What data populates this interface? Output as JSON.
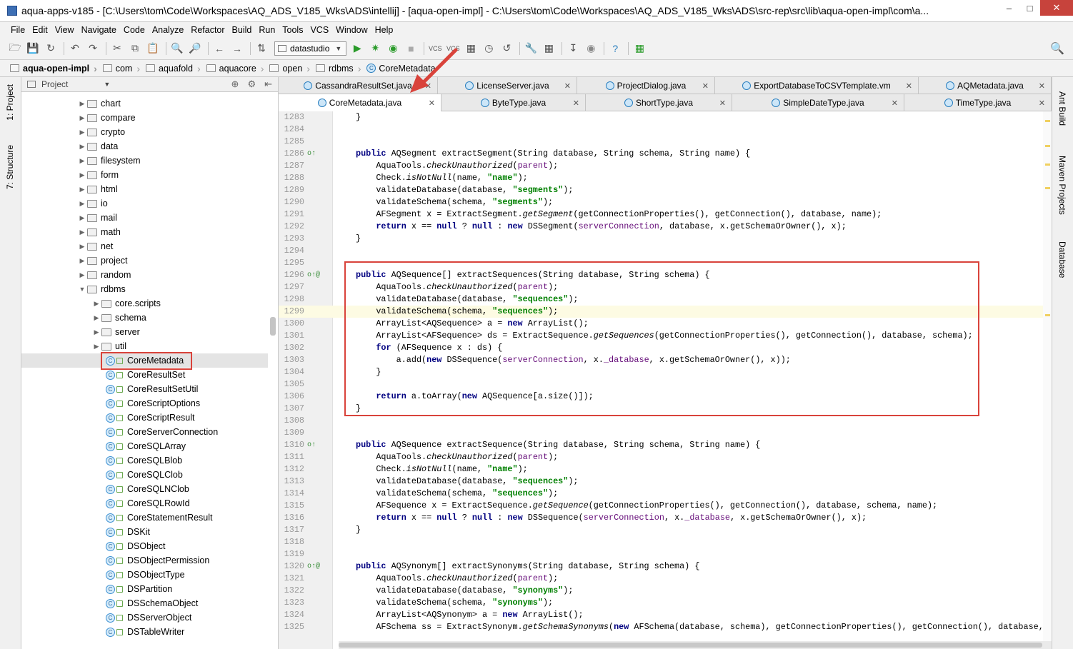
{
  "window": {
    "title": "aqua-apps-v185 - [C:\\Users\\tom\\Code\\Workspaces\\AQ_ADS_V185_Wks\\ADS\\intellij] - [aqua-open-impl] - C:\\Users\\tom\\Code\\Workspaces\\AQ_ADS_V185_Wks\\ADS\\src-rep\\src\\lib\\aqua-open-impl\\com\\a...",
    "buttons": {
      "minimize": "–",
      "maximize": "□",
      "close": "✕"
    }
  },
  "menu": [
    "File",
    "Edit",
    "View",
    "Navigate",
    "Code",
    "Analyze",
    "Refactor",
    "Build",
    "Run",
    "Tools",
    "VCS",
    "Window",
    "Help"
  ],
  "toolbar": {
    "run_config": "datastudio"
  },
  "breadcrumbs": [
    "aqua-open-impl",
    "com",
    "aquafold",
    "aquacore",
    "open",
    "rdbms",
    "CoreMetadata"
  ],
  "left_strip": {
    "project_tab": "1: Project",
    "structure_tab": "7: Structure"
  },
  "project_panel": {
    "header": "Project",
    "folders": [
      "chart",
      "compare",
      "crypto",
      "data",
      "filesystem",
      "form",
      "html",
      "io",
      "mail",
      "math",
      "net",
      "project",
      "random",
      "rdbms"
    ],
    "rdbms_children": [
      "core.scripts",
      "schema",
      "server",
      "util"
    ],
    "classes": [
      "CoreMetadata",
      "CoreResultSet",
      "CoreResultSetUtil",
      "CoreScriptOptions",
      "CoreScriptResult",
      "CoreServerConnection",
      "CoreSQLArray",
      "CoreSQLBlob",
      "CoreSQLClob",
      "CoreSQLNClob",
      "CoreSQLRowId",
      "CoreStatementResult",
      "DSKit",
      "DSObject",
      "DSObjectPermission",
      "DSObjectType",
      "DSPartition",
      "DSSchemaObject",
      "DSServerObject",
      "DSTableWriter"
    ],
    "selected": "CoreMetadata"
  },
  "tabs_row1": [
    "CassandraResultSet.java",
    "LicenseServer.java",
    "ProjectDialog.java",
    "ExportDatabaseToCSVTemplate.vm",
    "AQMetadata.java"
  ],
  "tabs_row2": [
    "CoreMetadata.java",
    "ByteType.java",
    "ShortType.java",
    "SimpleDateType.java",
    "TimeType.java"
  ],
  "right_strip": {
    "ant": "Ant Build",
    "maven": "Maven Projects",
    "database": "Database"
  },
  "code_lines": [
    {
      "n": "1283",
      "t": "}"
    },
    {
      "n": "1284",
      "t": ""
    },
    {
      "n": "1285",
      "t": ""
    },
    {
      "n": "1286",
      "t": "public AQSegment extractSegment(String database, String schema, String name) {"
    },
    {
      "n": "1287",
      "t": "    AquaTools.checkUnauthorized(parent);"
    },
    {
      "n": "1288",
      "t": "    Check.isNotNull(name, \"name\");"
    },
    {
      "n": "1289",
      "t": "    validateDatabase(database, \"segments\");"
    },
    {
      "n": "1290",
      "t": "    validateSchema(schema, \"segments\");"
    },
    {
      "n": "1291",
      "t": "    AFSegment x = ExtractSegment.getSegment(getConnectionProperties(), getConnection(), database, name);"
    },
    {
      "n": "1292",
      "t": "    return x == null ? null : new DSSegment(serverConnection, database, x.getSchemaOrOwner(), x);"
    },
    {
      "n": "1293",
      "t": "}"
    },
    {
      "n": "1294",
      "t": ""
    },
    {
      "n": "1295",
      "t": ""
    },
    {
      "n": "1296",
      "t": "public AQSequence[] extractSequences(String database, String schema) {"
    },
    {
      "n": "1297",
      "t": "    AquaTools.checkUnauthorized(parent);"
    },
    {
      "n": "1298",
      "t": "    validateDatabase(database, \"sequences\");"
    },
    {
      "n": "1299",
      "t": "    validateSchema(schema, \"sequences\");"
    },
    {
      "n": "1300",
      "t": "    ArrayList<AQSequence> a = new ArrayList();"
    },
    {
      "n": "1301",
      "t": "    ArrayList<AFSequence> ds = ExtractSequence.getSequences(getConnectionProperties(), getConnection(), database, schema);"
    },
    {
      "n": "1302",
      "t": "    for (AFSequence x : ds) {"
    },
    {
      "n": "1303",
      "t": "        a.add(new DSSequence(serverConnection, x._database, x.getSchemaOrOwner(), x));"
    },
    {
      "n": "1304",
      "t": "    }"
    },
    {
      "n": "1305",
      "t": ""
    },
    {
      "n": "1306",
      "t": "    return a.toArray(new AQSequence[a.size()]);"
    },
    {
      "n": "1307",
      "t": "}"
    },
    {
      "n": "1308",
      "t": ""
    },
    {
      "n": "1309",
      "t": ""
    },
    {
      "n": "1310",
      "t": "public AQSequence extractSequence(String database, String schema, String name) {"
    },
    {
      "n": "1311",
      "t": "    AquaTools.checkUnauthorized(parent);"
    },
    {
      "n": "1312",
      "t": "    Check.isNotNull(name, \"name\");"
    },
    {
      "n": "1313",
      "t": "    validateDatabase(database, \"sequences\");"
    },
    {
      "n": "1314",
      "t": "    validateSchema(schema, \"sequences\");"
    },
    {
      "n": "1315",
      "t": "    AFSequence x = ExtractSequence.getSequence(getConnectionProperties(), getConnection(), database, schema, name);"
    },
    {
      "n": "1316",
      "t": "    return x == null ? null : new DSSequence(serverConnection, x._database, x.getSchemaOrOwner(), x);"
    },
    {
      "n": "1317",
      "t": "}"
    },
    {
      "n": "1318",
      "t": ""
    },
    {
      "n": "1319",
      "t": ""
    },
    {
      "n": "1320",
      "t": "public AQSynonym[] extractSynonyms(String database, String schema) {"
    },
    {
      "n": "1321",
      "t": "    AquaTools.checkUnauthorized(parent);"
    },
    {
      "n": "1322",
      "t": "    validateDatabase(database, \"synonyms\");"
    },
    {
      "n": "1323",
      "t": "    validateSchema(schema, \"synonyms\");"
    },
    {
      "n": "1324",
      "t": "    ArrayList<AQSynonym> a = new ArrayList();"
    },
    {
      "n": "1325",
      "t": "    AFSchema ss = ExtractSynonym.getSchemaSynonyms(new AFSchema(database, schema), getConnectionProperties(), getConnection(), database, sc"
    }
  ],
  "current_line": "1299",
  "override_marks": {
    "1286": "o↑",
    "1296": "o↑@",
    "1310": "o↑",
    "1320": "o↑@"
  },
  "colors": {
    "highlight_box": "#d9433b",
    "keyword": "#000080",
    "string": "#008000"
  }
}
